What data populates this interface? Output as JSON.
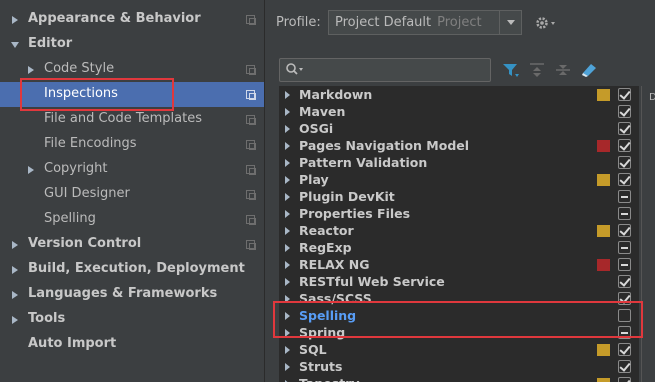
{
  "sidebar": {
    "items": [
      {
        "label": "Appearance & Behavior",
        "level": 0,
        "arrow": "collapsed",
        "copy_icon": true,
        "selected": false
      },
      {
        "label": "Editor",
        "level": 0,
        "arrow": "expanded",
        "copy_icon": false,
        "selected": false
      },
      {
        "label": "Code Style",
        "level": 1,
        "arrow": "collapsed",
        "copy_icon": true,
        "selected": false
      },
      {
        "label": "Inspections",
        "level": 1,
        "arrow": "none",
        "copy_icon": true,
        "selected": true
      },
      {
        "label": "File and Code Templates",
        "level": 1,
        "arrow": "none",
        "copy_icon": true,
        "selected": false
      },
      {
        "label": "File Encodings",
        "level": 1,
        "arrow": "none",
        "copy_icon": true,
        "selected": false
      },
      {
        "label": "Copyright",
        "level": 1,
        "arrow": "collapsed",
        "copy_icon": true,
        "selected": false
      },
      {
        "label": "GUI Designer",
        "level": 1,
        "arrow": "none",
        "copy_icon": true,
        "selected": false
      },
      {
        "label": "Spelling",
        "level": 1,
        "arrow": "none",
        "copy_icon": true,
        "selected": false
      },
      {
        "label": "Version Control",
        "level": 0,
        "arrow": "collapsed",
        "copy_icon": true,
        "selected": false
      },
      {
        "label": "Build, Execution, Deployment",
        "level": 0,
        "arrow": "collapsed",
        "copy_icon": false,
        "selected": false
      },
      {
        "label": "Languages & Frameworks",
        "level": 0,
        "arrow": "collapsed",
        "copy_icon": false,
        "selected": false
      },
      {
        "label": "Tools",
        "level": 0,
        "arrow": "collapsed",
        "copy_icon": false,
        "selected": false
      },
      {
        "label": "Auto Import",
        "level": 0,
        "arrow": "none",
        "copy_icon": false,
        "selected": false
      }
    ]
  },
  "profile": {
    "label": "Profile:",
    "value": "Project Default",
    "scope": "Project"
  },
  "right_strip_text": "D",
  "tree": {
    "rows": [
      {
        "label": "Markdown",
        "severity": "#c59b29",
        "check": "checked",
        "highlight": false
      },
      {
        "label": "Maven",
        "severity": "",
        "check": "checked",
        "highlight": false
      },
      {
        "label": "OSGi",
        "severity": "",
        "check": "checked",
        "highlight": false
      },
      {
        "label": "Pages Navigation Model",
        "severity": "#a7282a",
        "check": "checked",
        "highlight": false
      },
      {
        "label": "Pattern Validation",
        "severity": "",
        "check": "checked",
        "highlight": false
      },
      {
        "label": "Play",
        "severity": "#c59b29",
        "check": "checked",
        "highlight": false
      },
      {
        "label": "Plugin DevKit",
        "severity": "",
        "check": "mixed",
        "highlight": false
      },
      {
        "label": "Properties Files",
        "severity": "",
        "check": "mixed",
        "highlight": false
      },
      {
        "label": "Reactor",
        "severity": "#c59b29",
        "check": "checked",
        "highlight": false
      },
      {
        "label": "RegExp",
        "severity": "",
        "check": "mixed",
        "highlight": false
      },
      {
        "label": "RELAX NG",
        "severity": "#a7282a",
        "check": "mixed",
        "highlight": false
      },
      {
        "label": "RESTful Web Service",
        "severity": "",
        "check": "checked",
        "highlight": false
      },
      {
        "label": "Sass/SCSS",
        "severity": "",
        "check": "checked",
        "highlight": false
      },
      {
        "label": "Spelling",
        "severity": "",
        "check": "unchecked",
        "highlight": true
      },
      {
        "label": "Spring",
        "severity": "",
        "check": "mixed",
        "highlight": false
      },
      {
        "label": "SQL",
        "severity": "#c59b29",
        "check": "checked",
        "highlight": false
      },
      {
        "label": "Struts",
        "severity": "",
        "check": "checked",
        "highlight": false
      },
      {
        "label": "Tapestry",
        "severity": "#c59b29",
        "check": "checked",
        "highlight": false
      }
    ]
  },
  "icons": {
    "search": "search-icon",
    "filter": "filter-icon",
    "expand_all": "expand-all-icon",
    "collapse_all": "collapse-all-icon",
    "reset": "eraser-icon",
    "settings": "gear-icon",
    "copy": "copy-icon"
  },
  "colors": {
    "selection": "#4b6eaf",
    "annotation_red": "#e0383d",
    "link_blue": "#589df6",
    "filter_blue": "#3592c4"
  }
}
